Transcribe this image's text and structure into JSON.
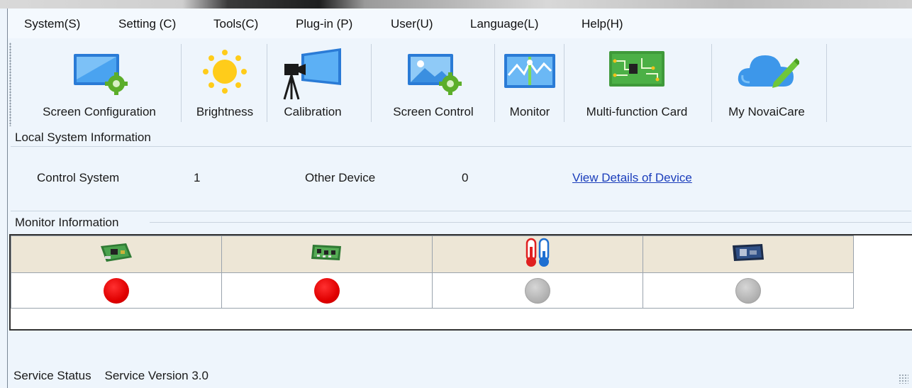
{
  "menu": [
    {
      "label": "System(S)"
    },
    {
      "label": "Setting (C)"
    },
    {
      "label": "Tools(C)"
    },
    {
      "label": "Plug-in (P)"
    },
    {
      "label": "User(U)"
    },
    {
      "label": "Language(L)"
    },
    {
      "label": "Help(H)"
    }
  ],
  "toolbar": [
    {
      "label": "Screen Configuration",
      "icon": "screen-configuration-icon"
    },
    {
      "label": "Brightness",
      "icon": "brightness-sun-icon"
    },
    {
      "label": "Calibration",
      "icon": "calibration-camera-icon"
    },
    {
      "label": "Screen Control",
      "icon": "screen-control-icon"
    },
    {
      "label": "Monitor",
      "icon": "monitor-icon"
    },
    {
      "label": "Multi-function Card",
      "icon": "circuit-board-icon"
    },
    {
      "label": "My NovaiCare",
      "icon": "cloud-edit-icon"
    }
  ],
  "local_system": {
    "title": "Local System Information",
    "control_system_label": "Control System",
    "control_system_value": "1",
    "other_device_label": "Other Device",
    "other_device_value": "0",
    "view_details_link": "View Details of Device"
  },
  "monitor": {
    "title": "Monitor Information",
    "columns": [
      {
        "icon": "sending-card-icon",
        "status": "red"
      },
      {
        "icon": "receiving-card-icon",
        "status": "red"
      },
      {
        "icon": "thermometer-icon",
        "status": "grey"
      },
      {
        "icon": "monitoring-card-icon",
        "status": "grey"
      }
    ]
  },
  "status": {
    "label": "Service Status",
    "version": "Service Version 3.0"
  },
  "colors": {
    "background": "#eef5fc",
    "link": "#1a3dbb",
    "status_red": "#e00000",
    "status_grey": "#b4b4b4",
    "table_header": "#ede6d6"
  }
}
